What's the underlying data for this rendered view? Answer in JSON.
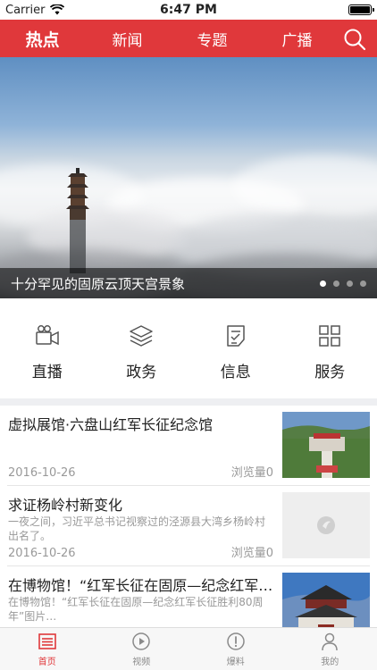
{
  "status_bar": {
    "carrier": "Carrier",
    "time": "6:47 PM",
    "battery_level": 1.0
  },
  "nav": {
    "tabs": [
      {
        "label": "热点",
        "active": true
      },
      {
        "label": "新闻",
        "active": false
      },
      {
        "label": "专题",
        "active": false
      },
      {
        "label": "广播",
        "active": false
      }
    ],
    "search_icon": "search-icon",
    "accent_color": "#e0383b"
  },
  "banner": {
    "caption": "十分罕见的固原云顶天宫景象",
    "slide_count": 4,
    "active_slide": 1
  },
  "quick_menu": [
    {
      "label": "直播",
      "icon": "video-camera-icon"
    },
    {
      "label": "政务",
      "icon": "layers-icon"
    },
    {
      "label": "信息",
      "icon": "document-check-icon"
    },
    {
      "label": "服务",
      "icon": "grid-icon"
    }
  ],
  "news": [
    {
      "title": "虚拟展馆·六盘山红军长征纪念馆",
      "summary": "",
      "date": "2016-10-26",
      "views": "浏览量0",
      "thumb": "photo"
    },
    {
      "title": "求证杨岭村新变化",
      "summary": "一夜之间，习近平总书记视察过的泾源县大湾乡杨岭村出名了。",
      "date": "2016-10-26",
      "views": "浏览量0",
      "thumb": "placeholder"
    },
    {
      "title": "在博物馆！“红军长征在固原—纪念红军…",
      "summary": "在博物馆！“红军长征在固原—纪念红军长征胜利80周年”图片…",
      "date": "",
      "views": "",
      "thumb": "photo"
    }
  ],
  "tab_bar": [
    {
      "label": "首页",
      "icon": "list-icon",
      "active": true
    },
    {
      "label": "视频",
      "icon": "play-icon",
      "active": false
    },
    {
      "label": "爆料",
      "icon": "alert-icon",
      "active": false
    },
    {
      "label": "我的",
      "icon": "user-icon",
      "active": false
    }
  ]
}
